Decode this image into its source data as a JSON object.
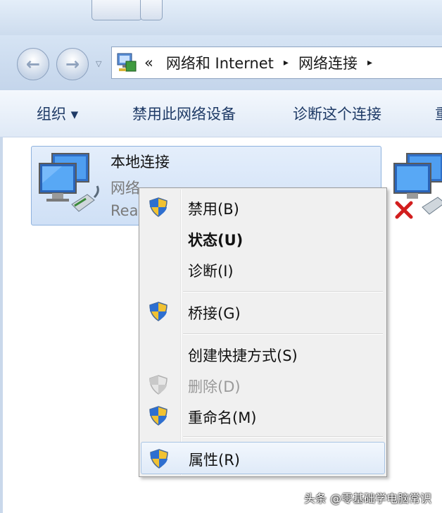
{
  "address": {
    "chevrons": "«",
    "crumbs": [
      "网络和 Internet",
      "网络连接"
    ],
    "sep": "▸"
  },
  "toolbar": {
    "organize": "组织 ▾",
    "disable": "禁用此网络设备",
    "diagnose": "诊断这个连接",
    "more": "重"
  },
  "connection": {
    "name": "本地连接",
    "type": "网络",
    "status": "Rea"
  },
  "context_menu": {
    "items": [
      {
        "label": "禁用(B)",
        "icon": "uac-shield-icon"
      },
      {
        "label": "状态(U)",
        "bold": true
      },
      {
        "label": "诊断(I)"
      },
      {
        "label": "桥接(G)",
        "icon": "uac-shield-icon"
      },
      {
        "label": "创建快捷方式(S)"
      },
      {
        "label": "删除(D)",
        "icon": "uac-shield-icon",
        "disabled": true
      },
      {
        "label": "重命名(M)",
        "icon": "uac-shield-icon"
      },
      {
        "label": "属性(R)",
        "icon": "uac-shield-icon",
        "highlighted": true
      }
    ]
  },
  "watermark": "头条 @零基础学电脑常识",
  "colors": {
    "accent": "#1e3a66",
    "menu_bg": "#f0f0f0",
    "tile_bg": "#dbe7f8",
    "error_red": "#d21e1e"
  }
}
